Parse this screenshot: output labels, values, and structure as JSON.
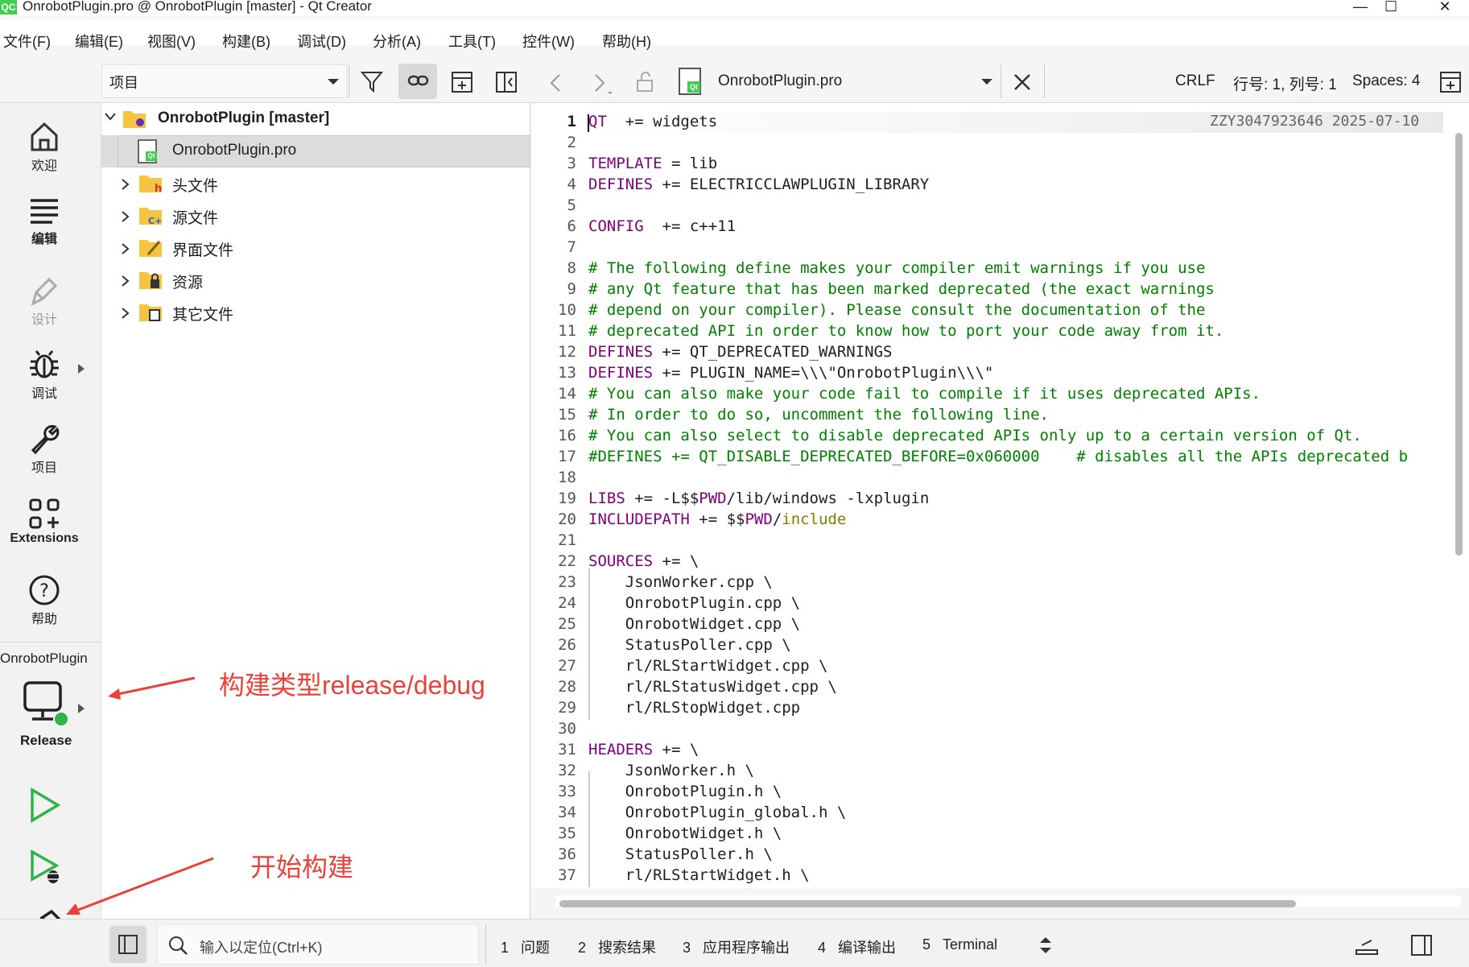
{
  "window": {
    "title": "OnrobotPlugin.pro @ OnrobotPlugin [master] - Qt Creator",
    "app_icon": "QC",
    "controls": [
      "—",
      "☐",
      "✕"
    ]
  },
  "menu": [
    "文件(F)",
    "编辑(E)",
    "视图(V)",
    "构建(B)",
    "调试(D)",
    "分析(A)",
    "工具(T)",
    "控件(W)",
    "帮助(H)"
  ],
  "modes": [
    {
      "label": "欢迎",
      "icon": "home-icon"
    },
    {
      "label": "编辑",
      "icon": "edit-lines-icon"
    },
    {
      "label": "设计",
      "icon": "pen-icon"
    },
    {
      "label": "调试",
      "icon": "bug-icon"
    },
    {
      "label": "项目",
      "icon": "wrench-icon"
    },
    {
      "label": "Extensions",
      "icon": "extensions-icon"
    },
    {
      "label": "帮助",
      "icon": "help-icon"
    }
  ],
  "kit": {
    "project": "OnrobotPlugin",
    "build_type": "Release"
  },
  "project_panel": {
    "view_label": "项目",
    "root": "OnrobotPlugin [master]",
    "selected_file": "OnrobotPlugin.pro",
    "folders": [
      "头文件",
      "源文件",
      "界面文件",
      "资源",
      "其它文件"
    ]
  },
  "editor_toolbar": {
    "file_name": "OnrobotPlugin.pro",
    "line_ending": "CRLF",
    "position": "行号: 1, 列号: 1",
    "indent": "Spaces: 4"
  },
  "blame": "ZZY3047923646 2025-07-10",
  "code_lines": [
    [
      [
        "kw",
        "QT"
      ],
      [
        "",
        "  += widgets"
      ]
    ],
    [],
    [
      [
        "kw",
        "TEMPLATE"
      ],
      [
        "",
        " = lib"
      ]
    ],
    [
      [
        "kw",
        "DEFINES"
      ],
      [
        "",
        "",
        " += ELECTRICCLAWPLUGIN_LIBRARY"
      ]
    ],
    [],
    [
      [
        "kw",
        "CONFIG"
      ],
      [
        "",
        "  += c++11"
      ]
    ],
    [],
    [
      [
        "cm",
        "# The following define makes your compiler emit warnings if you use"
      ]
    ],
    [
      [
        "cm",
        "# any Qt feature that has been marked deprecated (the exact warnings"
      ]
    ],
    [
      [
        "cm",
        "# depend on your compiler). Please consult the documentation of the"
      ]
    ],
    [
      [
        "cm",
        "# deprecated API in order to know how to port your code away from it."
      ]
    ],
    [
      [
        "kw",
        "DEFINES"
      ],
      [
        "",
        "",
        " += QT_DEPRECATED_WARNINGS"
      ]
    ],
    [
      [
        "kw",
        "DEFINES"
      ],
      [
        "",
        "",
        " += PLUGIN_NAME=\\\\\\\"OnrobotPlugin\\\\\\\""
      ]
    ],
    [
      [
        "cm",
        "# You can also make your code fail to compile if it uses deprecated APIs."
      ]
    ],
    [
      [
        "cm",
        "# In order to do so, uncomment the following line."
      ]
    ],
    [
      [
        "cm",
        "# You can also select to disable deprecated APIs only up to a certain version of Qt."
      ]
    ],
    [
      [
        "cm",
        "#DEFINES += QT_DISABLE_DEPRECATED_BEFORE=0x060000    # disables all the APIs deprecated b"
      ]
    ],
    [],
    [
      [
        "kw",
        "LIBS"
      ],
      [
        "",
        "",
        " += -L$$"
      ],
      [
        "var",
        "PWD"
      ],
      [
        "",
        "/lib/windows -lxplugin"
      ]
    ],
    [
      [
        "kw",
        "INCLUDEPATH"
      ],
      [
        "",
        "",
        " += $$"
      ],
      [
        "var",
        "PWD"
      ],
      [
        "",
        "/"
      ],
      [
        "inc",
        "include"
      ]
    ],
    [],
    [
      [
        "kw",
        "SOURCES"
      ],
      [
        "",
        "",
        " += \\"
      ]
    ],
    [
      [
        "",
        "    JsonWorker.cpp \\"
      ]
    ],
    [
      [
        "",
        "    OnrobotPlugin.cpp \\"
      ]
    ],
    [
      [
        "",
        "    OnrobotWidget.cpp \\"
      ]
    ],
    [
      [
        "",
        "    StatusPoller.cpp \\"
      ]
    ],
    [
      [
        "",
        "    rl/RLStartWidget.cpp \\"
      ]
    ],
    [
      [
        "",
        "    rl/RLStatusWidget.cpp \\"
      ]
    ],
    [
      [
        "",
        "    rl/RLStopWidget.cpp"
      ]
    ],
    [],
    [
      [
        "kw",
        "HEADERS"
      ],
      [
        "",
        "",
        " += \\"
      ]
    ],
    [
      [
        "",
        "    JsonWorker.h \\"
      ]
    ],
    [
      [
        "",
        "    OnrobotPlugin.h \\"
      ]
    ],
    [
      [
        "",
        "    OnrobotPlugin_global.h \\"
      ]
    ],
    [
      [
        "",
        "    OnrobotWidget.h \\"
      ]
    ],
    [
      [
        "",
        "    StatusPoller.h \\"
      ]
    ],
    [
      [
        "",
        "    rl/RLStartWidget.h \\"
      ]
    ]
  ],
  "status": {
    "locator_placeholder": "输入以定位(Ctrl+K)",
    "tabs": [
      {
        "num": "1",
        "label": "问题"
      },
      {
        "num": "2",
        "label": "搜索结果"
      },
      {
        "num": "3",
        "label": "应用程序输出"
      },
      {
        "num": "4",
        "label": "编译输出"
      },
      {
        "num": "5",
        "label": "Terminal"
      }
    ]
  },
  "annotations": {
    "build_type": "构建类型release/debug",
    "start_build": "开始构建"
  },
  "colors": {
    "keyword": "#800080",
    "comment": "#008000",
    "annotation": "#e8423a",
    "qt_green": "#41cd52"
  }
}
